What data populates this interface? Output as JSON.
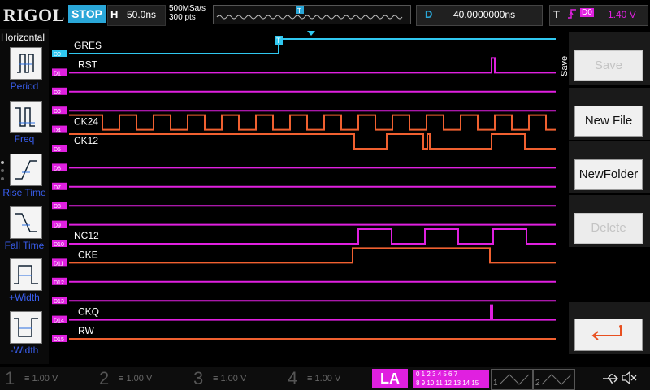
{
  "header": {
    "logo": "RIGOL",
    "run_state": "STOP",
    "h_label": "H",
    "timebase": "50.0ns",
    "sample_rate": "500MSa/s",
    "mem_depth": "300  pts",
    "d_label": "D",
    "delay": "40.0000000ns",
    "t_label": "T",
    "trigger_source": "D0",
    "trigger_level": "1.40 V"
  },
  "left_panel": {
    "title": "Horizontal",
    "items": [
      {
        "label": "Period"
      },
      {
        "label": "Freq"
      },
      {
        "label": "Rise Time"
      },
      {
        "label": "Fall Time"
      },
      {
        "label": "+Width"
      },
      {
        "label": "-Width"
      }
    ]
  },
  "channels": [
    {
      "tag": "D0",
      "name": "GRES"
    },
    {
      "tag": "D1",
      "name": "RST"
    },
    {
      "tag": "D2",
      "name": ""
    },
    {
      "tag": "D3",
      "name": ""
    },
    {
      "tag": "D4",
      "name": "CK24"
    },
    {
      "tag": "D5",
      "name": "CK12"
    },
    {
      "tag": "D6",
      "name": ""
    },
    {
      "tag": "D7",
      "name": ""
    },
    {
      "tag": "D8",
      "name": ""
    },
    {
      "tag": "D9",
      "name": ""
    },
    {
      "tag": "D10",
      "name": "NC12"
    },
    {
      "tag": "D11",
      "name": "CKE"
    },
    {
      "tag": "D12",
      "name": ""
    },
    {
      "tag": "D13",
      "name": ""
    },
    {
      "tag": "D14",
      "name": "CKQ"
    },
    {
      "tag": "D15",
      "name": "RW"
    }
  ],
  "right_menu": {
    "title": "Save",
    "save": "Save",
    "new_file": "New File",
    "new_folder": "NewFolder",
    "delete": "Delete"
  },
  "bottom": {
    "ch1": {
      "num": "1",
      "value": "1.00 V"
    },
    "ch2": {
      "num": "2",
      "value": "1.00 V"
    },
    "ch3": {
      "num": "3",
      "value": "1.00 V"
    },
    "ch4": {
      "num": "4",
      "value": "1.00 V"
    },
    "la": "LA",
    "la_row1": "0 1 2 3   4 5 6 7",
    "la_row2": "8 9 10 11  12 13 14 15",
    "ref1": "1",
    "ref2": "2"
  },
  "colors": {
    "digital": "#e020e0",
    "active_digital": "#f06030",
    "trigger_channel": "#30c8f0",
    "accent": "#2aa7d8"
  }
}
